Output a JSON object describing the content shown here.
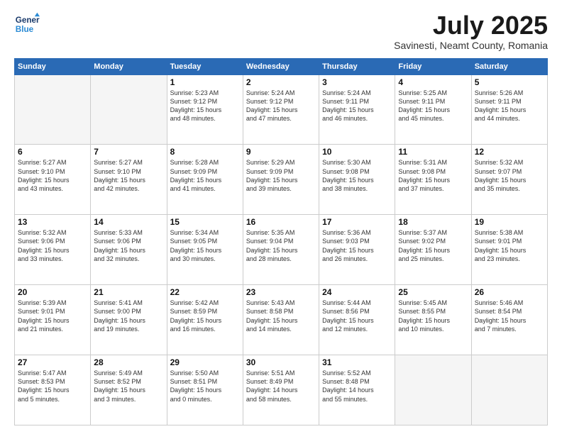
{
  "header": {
    "logo_line1": "General",
    "logo_line2": "Blue",
    "month": "July 2025",
    "location": "Savinesti, Neamt County, Romania"
  },
  "days_of_week": [
    "Sunday",
    "Monday",
    "Tuesday",
    "Wednesday",
    "Thursday",
    "Friday",
    "Saturday"
  ],
  "weeks": [
    [
      {
        "day": "",
        "text": ""
      },
      {
        "day": "",
        "text": ""
      },
      {
        "day": "1",
        "text": "Sunrise: 5:23 AM\nSunset: 9:12 PM\nDaylight: 15 hours\nand 48 minutes."
      },
      {
        "day": "2",
        "text": "Sunrise: 5:24 AM\nSunset: 9:12 PM\nDaylight: 15 hours\nand 47 minutes."
      },
      {
        "day": "3",
        "text": "Sunrise: 5:24 AM\nSunset: 9:11 PM\nDaylight: 15 hours\nand 46 minutes."
      },
      {
        "day": "4",
        "text": "Sunrise: 5:25 AM\nSunset: 9:11 PM\nDaylight: 15 hours\nand 45 minutes."
      },
      {
        "day": "5",
        "text": "Sunrise: 5:26 AM\nSunset: 9:11 PM\nDaylight: 15 hours\nand 44 minutes."
      }
    ],
    [
      {
        "day": "6",
        "text": "Sunrise: 5:27 AM\nSunset: 9:10 PM\nDaylight: 15 hours\nand 43 minutes."
      },
      {
        "day": "7",
        "text": "Sunrise: 5:27 AM\nSunset: 9:10 PM\nDaylight: 15 hours\nand 42 minutes."
      },
      {
        "day": "8",
        "text": "Sunrise: 5:28 AM\nSunset: 9:09 PM\nDaylight: 15 hours\nand 41 minutes."
      },
      {
        "day": "9",
        "text": "Sunrise: 5:29 AM\nSunset: 9:09 PM\nDaylight: 15 hours\nand 39 minutes."
      },
      {
        "day": "10",
        "text": "Sunrise: 5:30 AM\nSunset: 9:08 PM\nDaylight: 15 hours\nand 38 minutes."
      },
      {
        "day": "11",
        "text": "Sunrise: 5:31 AM\nSunset: 9:08 PM\nDaylight: 15 hours\nand 37 minutes."
      },
      {
        "day": "12",
        "text": "Sunrise: 5:32 AM\nSunset: 9:07 PM\nDaylight: 15 hours\nand 35 minutes."
      }
    ],
    [
      {
        "day": "13",
        "text": "Sunrise: 5:32 AM\nSunset: 9:06 PM\nDaylight: 15 hours\nand 33 minutes."
      },
      {
        "day": "14",
        "text": "Sunrise: 5:33 AM\nSunset: 9:06 PM\nDaylight: 15 hours\nand 32 minutes."
      },
      {
        "day": "15",
        "text": "Sunrise: 5:34 AM\nSunset: 9:05 PM\nDaylight: 15 hours\nand 30 minutes."
      },
      {
        "day": "16",
        "text": "Sunrise: 5:35 AM\nSunset: 9:04 PM\nDaylight: 15 hours\nand 28 minutes."
      },
      {
        "day": "17",
        "text": "Sunrise: 5:36 AM\nSunset: 9:03 PM\nDaylight: 15 hours\nand 26 minutes."
      },
      {
        "day": "18",
        "text": "Sunrise: 5:37 AM\nSunset: 9:02 PM\nDaylight: 15 hours\nand 25 minutes."
      },
      {
        "day": "19",
        "text": "Sunrise: 5:38 AM\nSunset: 9:01 PM\nDaylight: 15 hours\nand 23 minutes."
      }
    ],
    [
      {
        "day": "20",
        "text": "Sunrise: 5:39 AM\nSunset: 9:01 PM\nDaylight: 15 hours\nand 21 minutes."
      },
      {
        "day": "21",
        "text": "Sunrise: 5:41 AM\nSunset: 9:00 PM\nDaylight: 15 hours\nand 19 minutes."
      },
      {
        "day": "22",
        "text": "Sunrise: 5:42 AM\nSunset: 8:59 PM\nDaylight: 15 hours\nand 16 minutes."
      },
      {
        "day": "23",
        "text": "Sunrise: 5:43 AM\nSunset: 8:58 PM\nDaylight: 15 hours\nand 14 minutes."
      },
      {
        "day": "24",
        "text": "Sunrise: 5:44 AM\nSunset: 8:56 PM\nDaylight: 15 hours\nand 12 minutes."
      },
      {
        "day": "25",
        "text": "Sunrise: 5:45 AM\nSunset: 8:55 PM\nDaylight: 15 hours\nand 10 minutes."
      },
      {
        "day": "26",
        "text": "Sunrise: 5:46 AM\nSunset: 8:54 PM\nDaylight: 15 hours\nand 7 minutes."
      }
    ],
    [
      {
        "day": "27",
        "text": "Sunrise: 5:47 AM\nSunset: 8:53 PM\nDaylight: 15 hours\nand 5 minutes."
      },
      {
        "day": "28",
        "text": "Sunrise: 5:49 AM\nSunset: 8:52 PM\nDaylight: 15 hours\nand 3 minutes."
      },
      {
        "day": "29",
        "text": "Sunrise: 5:50 AM\nSunset: 8:51 PM\nDaylight: 15 hours\nand 0 minutes."
      },
      {
        "day": "30",
        "text": "Sunrise: 5:51 AM\nSunset: 8:49 PM\nDaylight: 14 hours\nand 58 minutes."
      },
      {
        "day": "31",
        "text": "Sunrise: 5:52 AM\nSunset: 8:48 PM\nDaylight: 14 hours\nand 55 minutes."
      },
      {
        "day": "",
        "text": ""
      },
      {
        "day": "",
        "text": ""
      }
    ]
  ]
}
